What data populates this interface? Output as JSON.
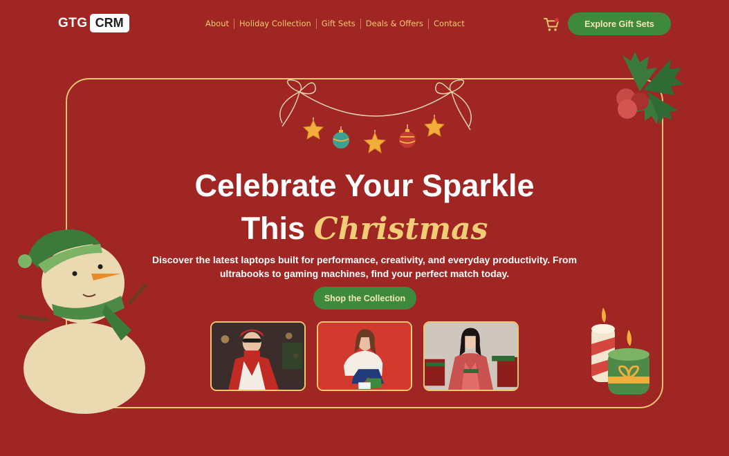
{
  "header": {
    "logo_part1": "GTG",
    "logo_part2": "CRM",
    "nav": [
      "About",
      "Holiday Collection",
      "Gift Sets",
      "Deals & Offers",
      "Contact"
    ],
    "cta_label": "Explore Gift Sets",
    "cart_icon": "cart-icon"
  },
  "hero": {
    "headline_line1": "Celebrate Your Sparkle",
    "headline_line2_prefix": "This",
    "headline_line2_script": "Christmas",
    "description": "Discover the latest laptops built for performance, creativity, and everyday productivity. From ultrabooks to gaming machines, find your perfect match today.",
    "cta_label": "Shop the Collection"
  },
  "colors": {
    "background": "#a02624",
    "accent_gold": "#f0c672",
    "button_green": "#3d8a3e"
  }
}
